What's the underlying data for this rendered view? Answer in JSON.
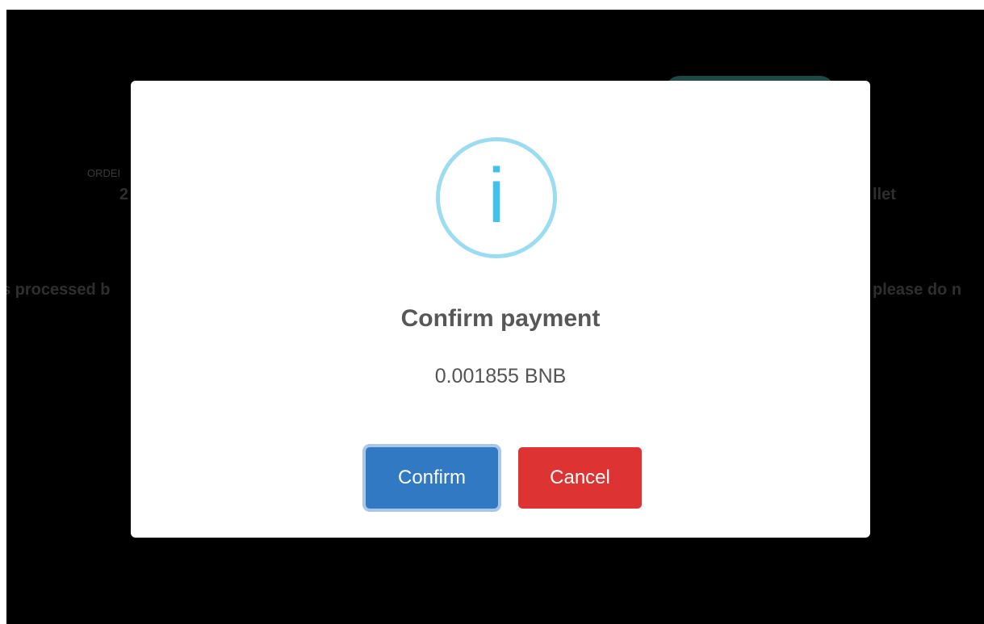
{
  "background": {
    "order_label": "ORDEI",
    "order_value": "2",
    "wallet_fragment": "llet",
    "processed_fragment": "s processed b",
    "please_fragment": "please do n"
  },
  "modal": {
    "icon": "info-icon",
    "icon_glyph": "i",
    "title": "Confirm payment",
    "text": "0.001855 BNB",
    "confirm_label": "Confirm",
    "cancel_label": "Cancel"
  },
  "colors": {
    "confirm": "#3179c2",
    "cancel": "#dd3333",
    "icon_ring": "#9bdcf2",
    "icon_glyph": "#3fc3ee"
  }
}
